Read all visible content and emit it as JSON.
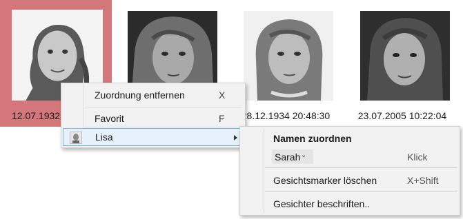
{
  "photos": [
    {
      "caption": "12.07.1932"
    },
    {
      "caption": ""
    },
    {
      "caption": "28.12.1934 20:48:30"
    },
    {
      "caption": "23.07.2005 10:22:04"
    }
  ],
  "context_menu": {
    "items": [
      {
        "label": "Zuordnung entfernen",
        "shortcut": "X"
      },
      {
        "label": "Favorit",
        "shortcut": "F"
      },
      {
        "label": "Lisa",
        "icon": "person-thumbnail-icon",
        "submenu_arrow": "chevron-right-icon"
      }
    ]
  },
  "submenu": {
    "header": "Namen zuordnen",
    "name_dropdown": {
      "value": "Sarah",
      "icon": "chevron-down-icon"
    },
    "name_dropdown_hint": "Klick",
    "delete_marker": {
      "label": "Gesichtsmarker löschen",
      "shortcut": "X+Shift"
    },
    "label_faces": {
      "label": "Gesichter beschriften.."
    }
  },
  "colors": {
    "selection": "#d4777a",
    "menu_bg": "#f2f2f2",
    "highlight_bg": "#e6f1fb",
    "highlight_border": "#78b4e0"
  }
}
